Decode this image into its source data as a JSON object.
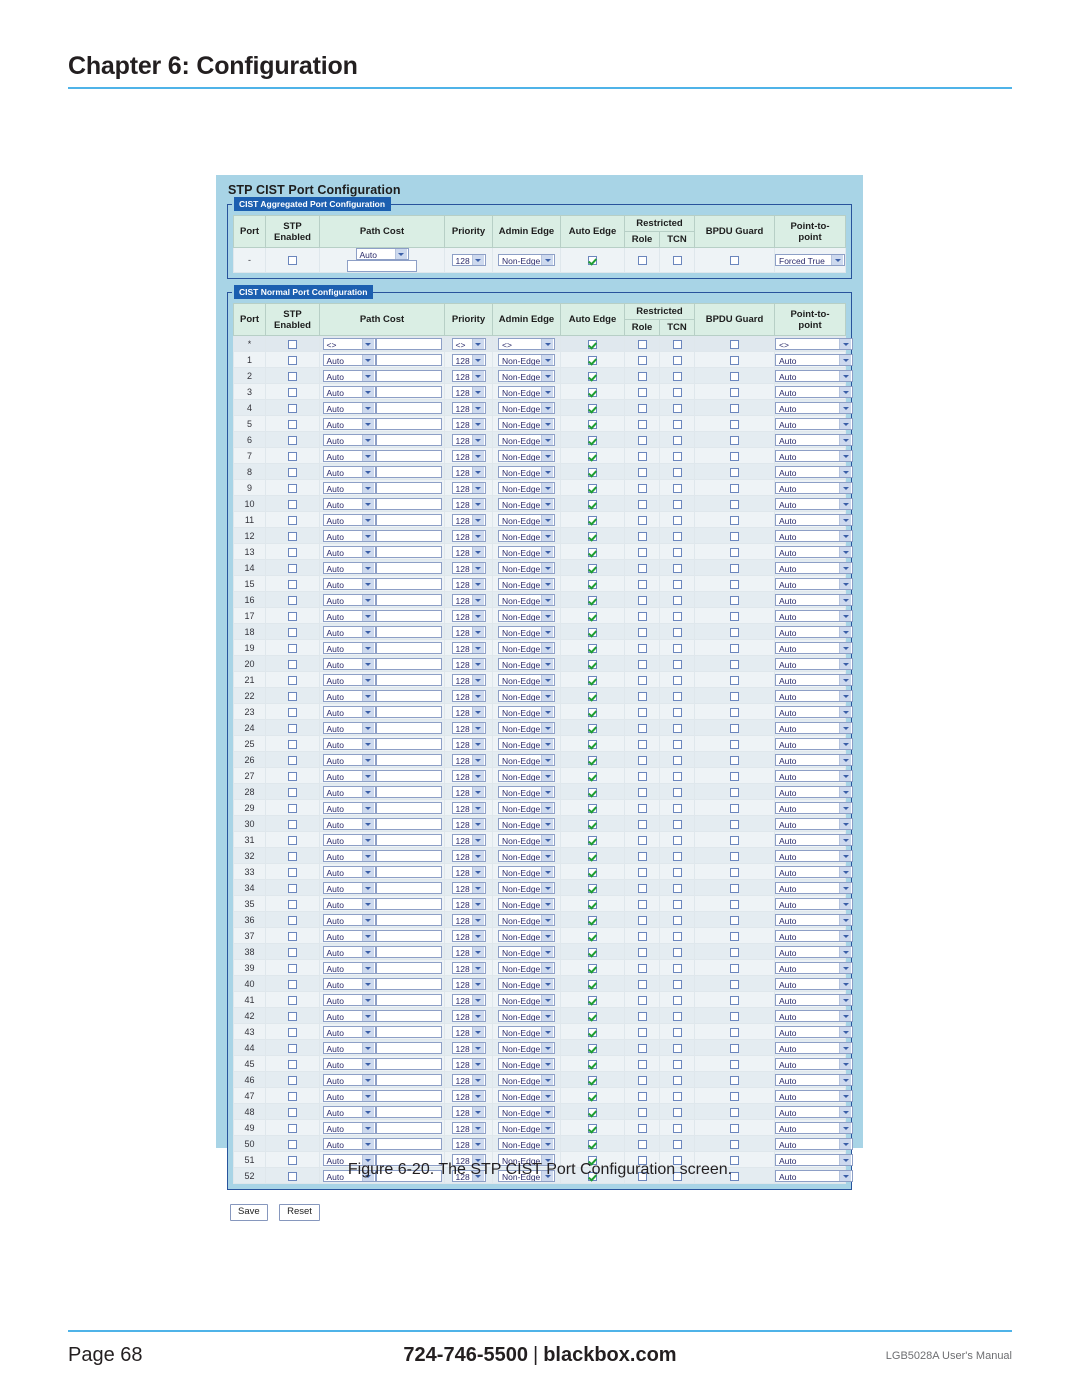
{
  "document": {
    "chapter_title": "Chapter 6: Configuration",
    "figure_caption": "Figure 6-20. The STP CIST Port Configuration screen.",
    "footer": {
      "page_label": "Page 68",
      "phone": "724-746-5500",
      "separator": "|",
      "website": "blackbox.com",
      "manual": "LGB5028A User's Manual"
    },
    "accent_color": "#4fb3e8"
  },
  "screenshot": {
    "panel_title": "STP CIST Port Configuration",
    "panel_background": "#a8d4e6",
    "legend_background": "#1c5fb0",
    "header_background": "#daeee4",
    "columns": [
      "Port",
      "STP Enabled",
      "Path Cost",
      "Priority",
      "Admin Edge",
      "Auto Edge",
      "Restricted",
      "BPDU Guard",
      "Point-to-point"
    ],
    "column_labels": {
      "port": "Port",
      "stp_enabled_line1": "STP",
      "stp_enabled_line2": "Enabled",
      "path_cost": "Path Cost",
      "priority": "Priority",
      "admin_edge": "Admin Edge",
      "auto_edge": "Auto Edge",
      "restricted": "Restricted",
      "restricted_role": "Role",
      "restricted_tcn": "TCN",
      "bpdu_guard": "BPDU Guard",
      "point_to_point_line1": "Point-to-",
      "point_to_point_line2": "point"
    },
    "aggregated": {
      "legend": "CIST Aggregated Port Configuration",
      "row": {
        "port": "-",
        "stp_enabled": false,
        "path_cost": "Auto",
        "path_cost_value": "",
        "priority": "128",
        "admin_edge": "Non-Edge",
        "auto_edge": true,
        "restricted_role": false,
        "restricted_tcn": false,
        "bpdu_guard": false,
        "point_to_point": "Forced True"
      }
    },
    "normal": {
      "legend": "CIST Normal Port Configuration",
      "star_row": {
        "port": "*",
        "stp_enabled": false,
        "path_cost": "<>",
        "path_cost_value": "",
        "priority": "<>",
        "admin_edge": "<>",
        "auto_edge": true,
        "restricted_role": false,
        "restricted_tcn": false,
        "bpdu_guard": false,
        "point_to_point": "<>"
      },
      "row_defaults": {
        "stp_enabled": false,
        "path_cost": "Auto",
        "path_cost_value": "",
        "priority": "128",
        "admin_edge": "Non-Edge",
        "auto_edge": true,
        "restricted_role": false,
        "restricted_tcn": false,
        "bpdu_guard": false,
        "point_to_point": "Auto"
      },
      "ports": [
        1,
        2,
        3,
        4,
        5,
        6,
        7,
        8,
        9,
        10,
        11,
        12,
        13,
        14,
        15,
        16,
        17,
        18,
        19,
        20,
        21,
        22,
        23,
        24,
        25,
        26,
        27,
        28,
        29,
        30,
        31,
        32,
        33,
        34,
        35,
        36,
        37,
        38,
        39,
        40,
        41,
        42,
        43,
        44,
        45,
        46,
        47,
        48,
        49,
        50,
        51,
        52
      ]
    },
    "buttons": {
      "save": "Save",
      "reset": "Reset"
    }
  }
}
